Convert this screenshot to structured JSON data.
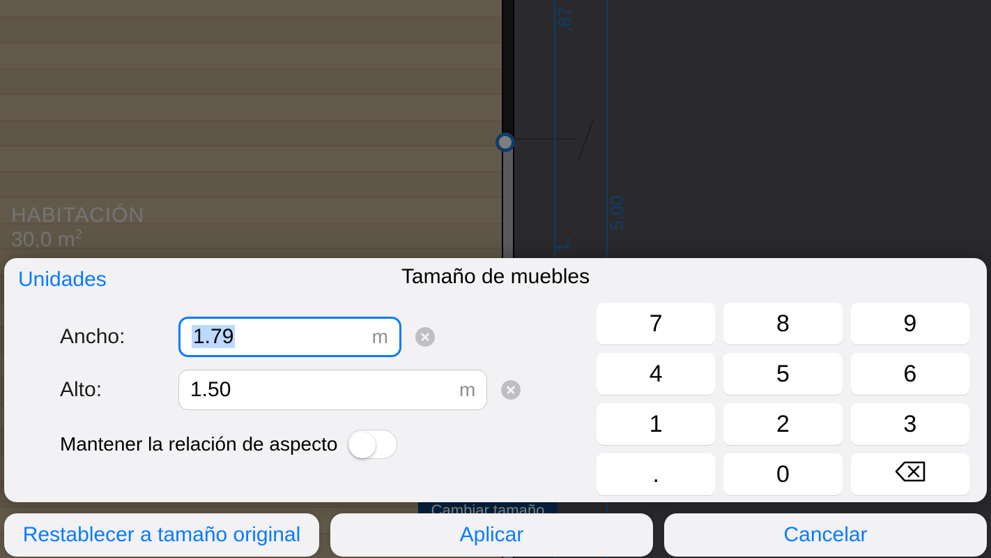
{
  "background": {
    "room_name": "HABITACIÓN",
    "room_area": "30,0 m²",
    "outer_dim_top": ",87",
    "outer_dim": "5,00",
    "inner_dim": "1,",
    "change_button": "Cambiar tamaño"
  },
  "panel": {
    "units_label": "Unidades",
    "title": "Tamaño de muebles",
    "width_label": "Ancho:",
    "width_value": "1.79",
    "width_unit": "m",
    "height_label": "Alto:",
    "height_value": "1.50",
    "height_unit": "m",
    "aspect_label": "Mantener la relación de aspecto",
    "aspect_on": false
  },
  "keypad": {
    "keys": [
      "7",
      "8",
      "9",
      "4",
      "5",
      "6",
      "1",
      "2",
      "3",
      ".",
      "0",
      "⌫"
    ]
  },
  "actions": {
    "reset": "Restablecer a tamaño original",
    "apply": "Aplicar",
    "cancel": "Cancelar"
  },
  "colors": {
    "accent": "#0a7bff",
    "panel_bg": "#f2f2f5",
    "dim_blue": "#1e6fbf"
  }
}
